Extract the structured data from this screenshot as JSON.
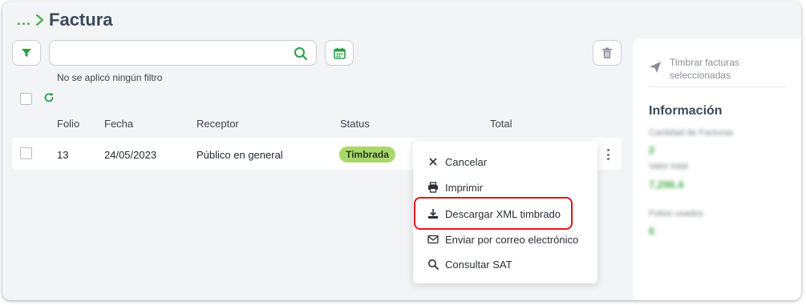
{
  "breadcrumb": {
    "ellipsis": "...",
    "title": "Factura"
  },
  "toolbar": {
    "filter_icon": "filter-icon",
    "search_placeholder": "",
    "search_icon": "search-icon",
    "calendar_icon": "calendar-icon",
    "trash_icon": "trash-icon"
  },
  "filter_status": "No se aplicó ningún filtro",
  "table": {
    "columns": [
      "Folio",
      "Fecha",
      "Receptor",
      "Status",
      "Total"
    ],
    "rows": [
      {
        "folio": "13",
        "fecha": "24/05/2023",
        "receptor": "Público en general",
        "status": "Timbrada",
        "total": ""
      }
    ]
  },
  "context_menu": {
    "items": [
      {
        "label": "Cancelar",
        "icon": "close-icon"
      },
      {
        "label": "Imprimir",
        "icon": "printer-icon"
      },
      {
        "label": "Descargar XML timbrado",
        "icon": "download-icon",
        "highlighted": true
      },
      {
        "label": "Enviar por correo electrónico",
        "icon": "mail-icon"
      },
      {
        "label": "Consultar SAT",
        "icon": "search-icon"
      }
    ]
  },
  "side_panel": {
    "action_label": "Timbrar facturas seleccionadas",
    "info_title": "Información",
    "stats": [
      {
        "label": "Cantidad de Facturas",
        "value": "2"
      },
      {
        "label": "Valor total",
        "value": "7,296.4"
      },
      {
        "label": "Folios usados",
        "value": "6"
      }
    ]
  },
  "colors": {
    "accent": "#4caf50",
    "badge": "#a8d86a",
    "highlight": "#e0161d"
  }
}
